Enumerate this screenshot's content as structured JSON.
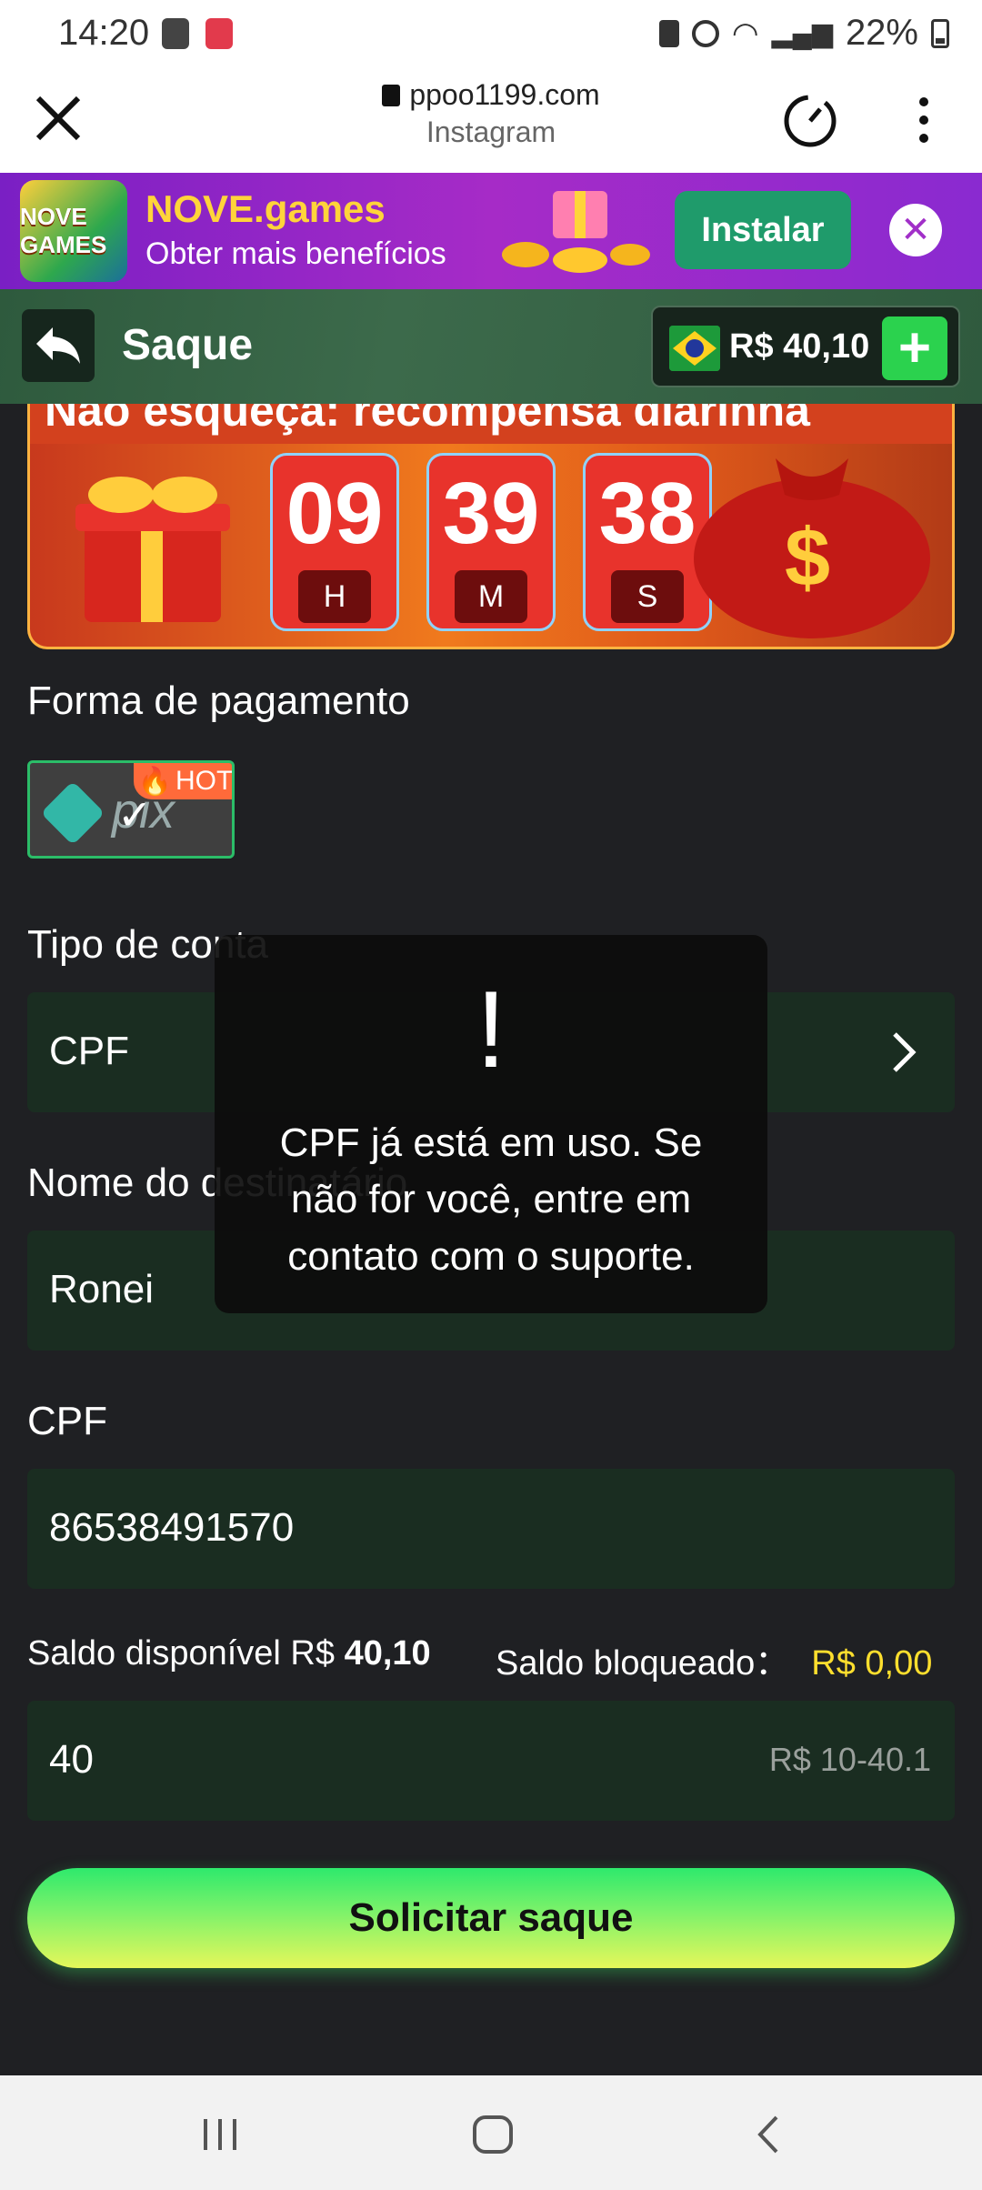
{
  "status": {
    "time": "14:20",
    "battery": "22%"
  },
  "browser": {
    "url": "ppoo1199.com",
    "source": "Instagram"
  },
  "install_banner": {
    "app_name": "NOVE.games",
    "tagline": "Obter mais benefícios",
    "install_label": "Instalar",
    "logo_text": "NOVE GAMES"
  },
  "header": {
    "title": "Saque",
    "balance": "R$ 40,10"
  },
  "promo": {
    "headline": "Não esqueça: recompensa diárinha",
    "countdown": [
      {
        "value": "09",
        "unit": "H"
      },
      {
        "value": "39",
        "unit": "M"
      },
      {
        "value": "38",
        "unit": "S"
      }
    ]
  },
  "form": {
    "payment_label": "Forma de pagamento",
    "payment_method": "pix",
    "hot_badge": "HOT",
    "account_type_label": "Tipo de conta",
    "account_type_value": "CPF",
    "recipient_label": "Nome do destinatário",
    "recipient_value": "Ronei",
    "cpf_label": "CPF",
    "cpf_value": "86538491570",
    "available_label": "Saldo disponível R$",
    "available_value": "40,10",
    "blocked_label": "Saldo bloqueado：",
    "blocked_value": "R$ 0,00",
    "amount_value": "40",
    "amount_range": "R$ 10-40.1",
    "submit_label": "Solicitar saque"
  },
  "toast": {
    "icon": "!",
    "message": "CPF já está em uso. Se não for você, entre em contato com o suporte."
  },
  "colors": {
    "accent_green": "#2bd24e",
    "field_bg": "#1a2d21",
    "page_bg": "#1f2023",
    "yellow": "#ffdf2e"
  }
}
